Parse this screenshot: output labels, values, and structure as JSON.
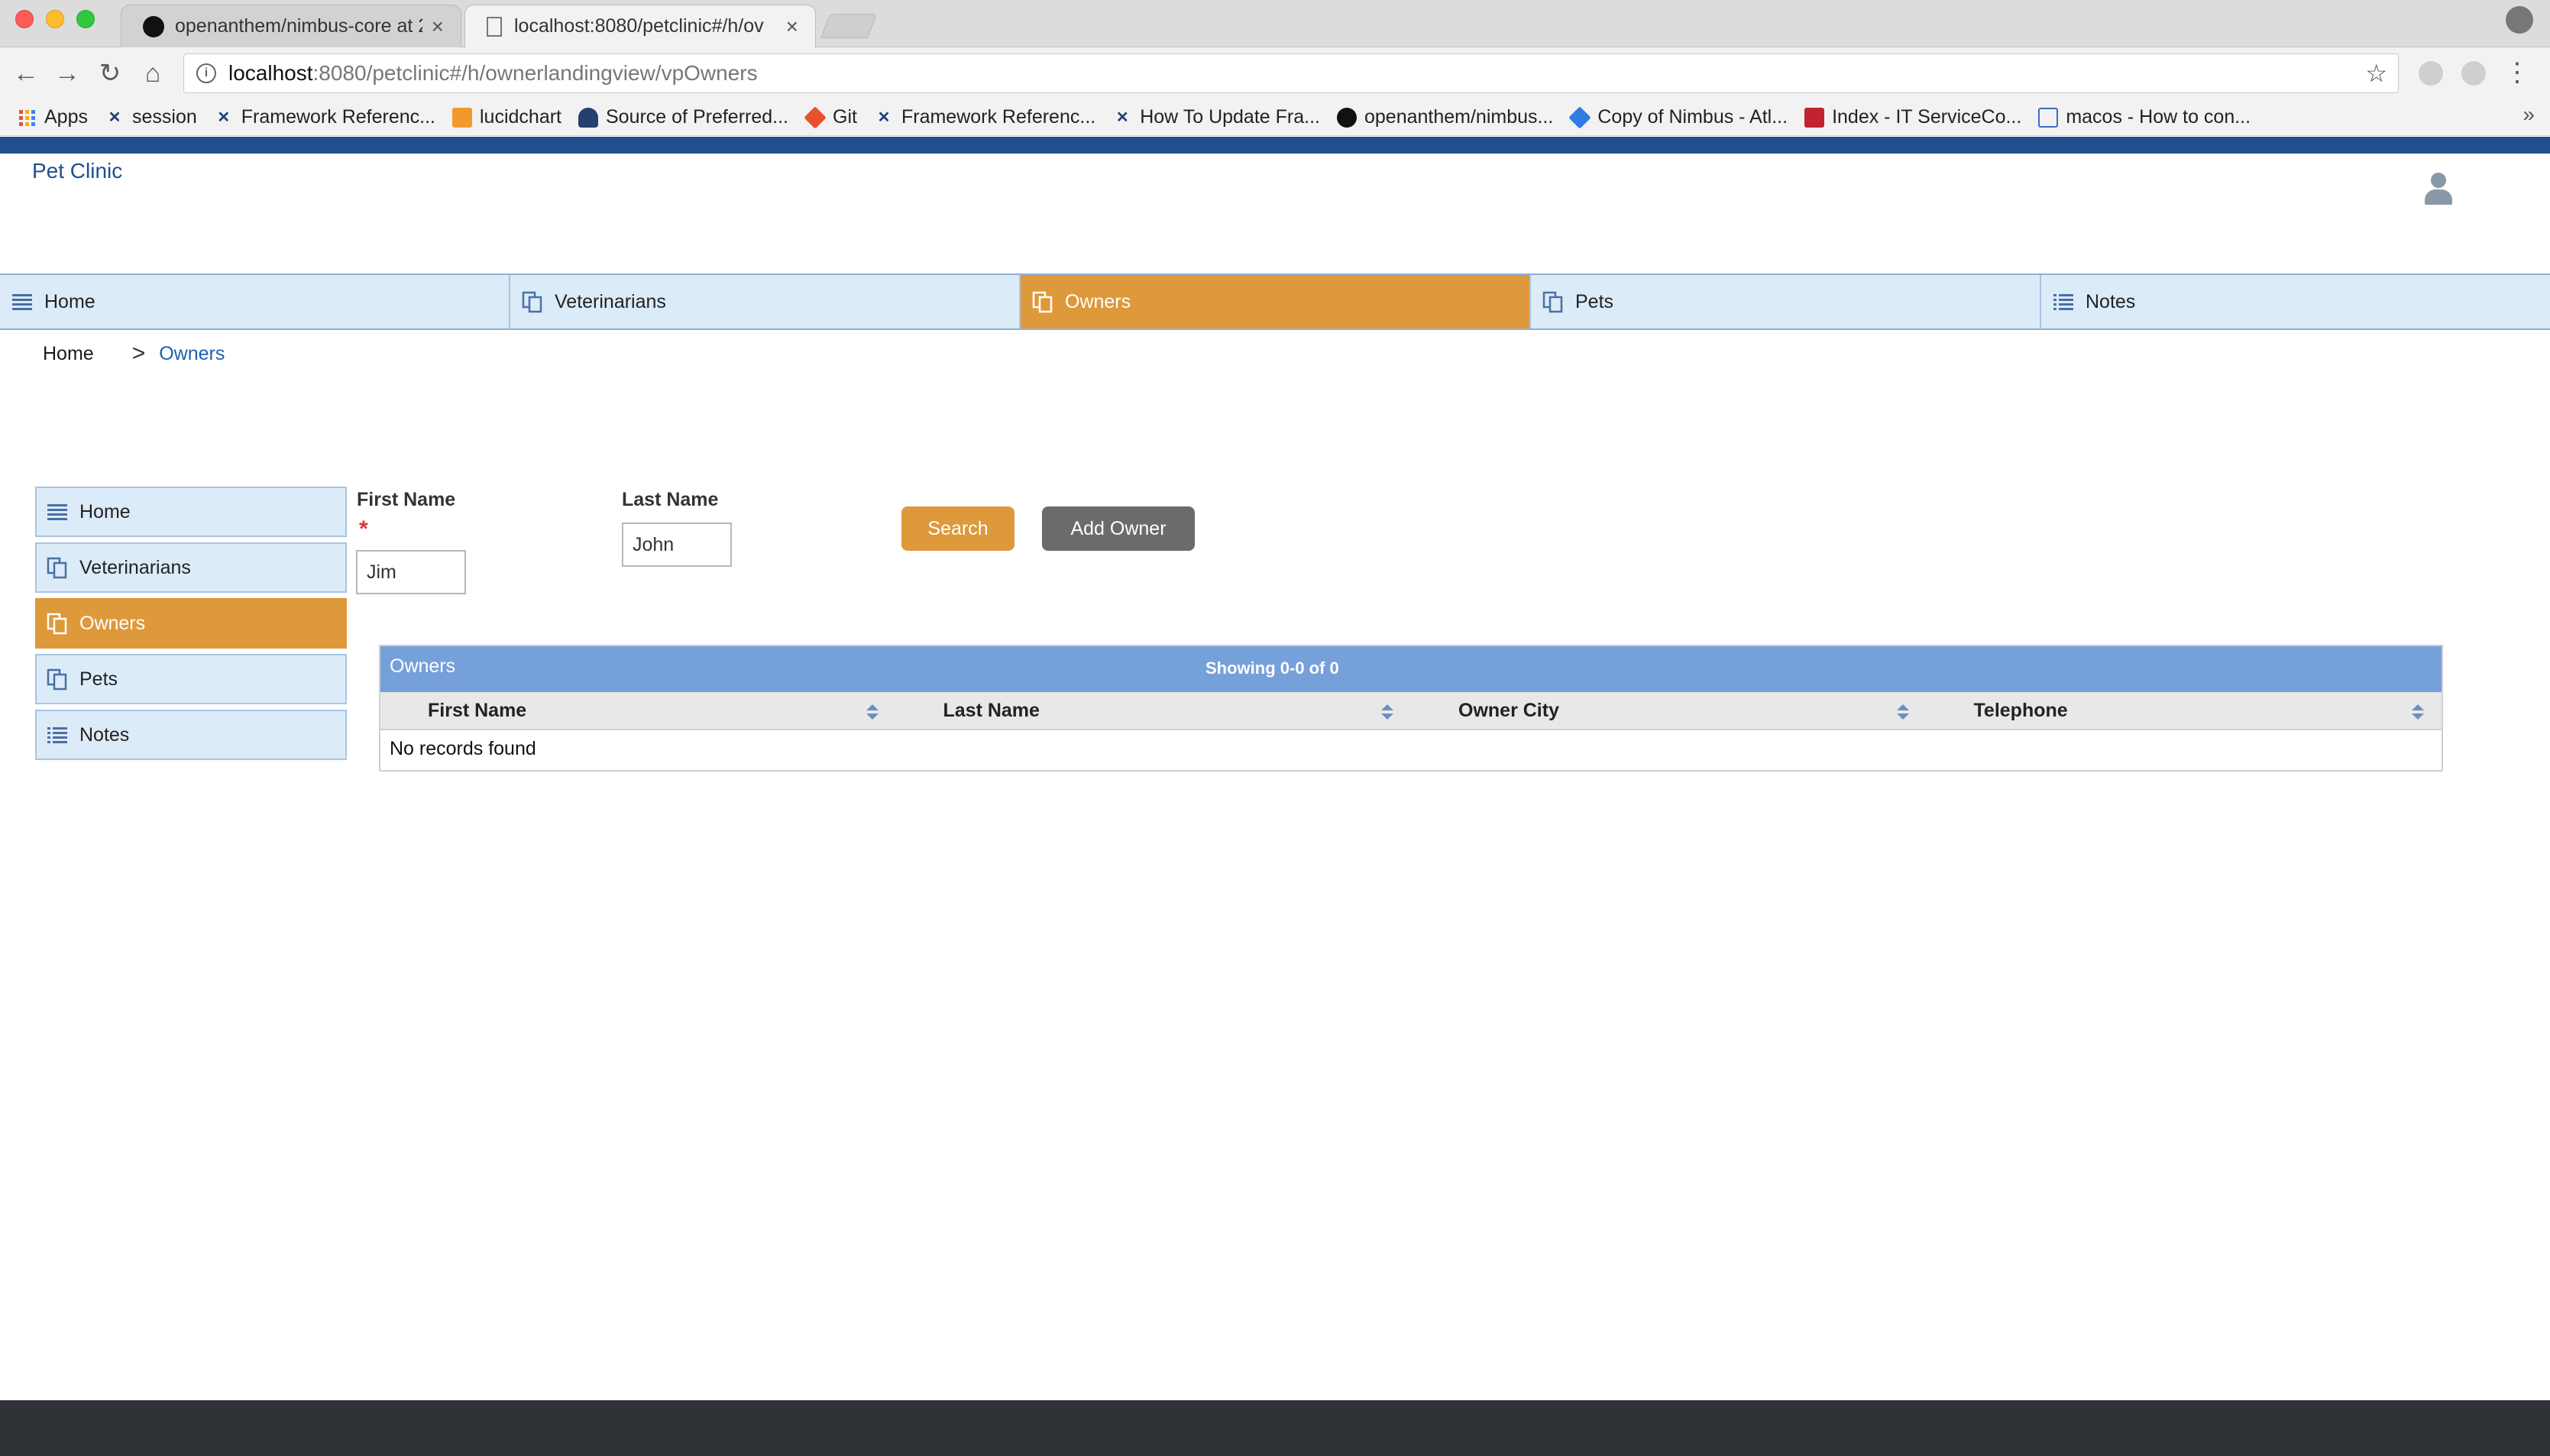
{
  "browser": {
    "tabs": [
      {
        "title": "openanthem/nimbus-core at 2",
        "active": false
      },
      {
        "title": "localhost:8080/petclinic#/h/ov",
        "active": true
      }
    ],
    "url_host": "localhost",
    "url_path": ":8080/petclinic#/h/ownerlandingview/vpOwners",
    "bookmarks": [
      {
        "label": "Apps",
        "icon": "apps-grid-icon",
        "color": "#e0533d"
      },
      {
        "label": "session",
        "icon": "framework-x-icon",
        "color": "#1f3f7a"
      },
      {
        "label": "Framework Referenc...",
        "icon": "framework-x-icon",
        "color": "#1f3f7a"
      },
      {
        "label": "lucidchart",
        "icon": "lucidchart-icon",
        "color": "#f09a2b"
      },
      {
        "label": "Source of Preferred...",
        "icon": "source-icon",
        "color": "#25406e"
      },
      {
        "label": "Git",
        "icon": "git-icon",
        "color": "#e8512d"
      },
      {
        "label": "Framework Referenc...",
        "icon": "framework-x-icon",
        "color": "#1f3f7a"
      },
      {
        "label": "How To Update Fra...",
        "icon": "framework-x-icon",
        "color": "#1f3f7a"
      },
      {
        "label": "openanthem/nimbus...",
        "icon": "github-icon",
        "color": "#111111"
      },
      {
        "label": "Copy of Nimbus - Atl...",
        "icon": "confluence-icon",
        "color": "#2f7de0"
      },
      {
        "label": "Index - IT ServiceCo...",
        "icon": "servicenow-icon",
        "color": "#c0242f"
      },
      {
        "label": "macos - How to con...",
        "icon": "document-icon",
        "color": "#3c6bc4"
      }
    ]
  },
  "app": {
    "brand": "Pet Clinic",
    "colors": {
      "primary": "#1f4f8f",
      "accent": "#dd993a",
      "nav_bg": "#dcebf8",
      "grid_header": "#76a0da"
    },
    "main_nav": [
      {
        "label": "Home",
        "icon": "list-icon",
        "active": false
      },
      {
        "label": "Veterinarians",
        "icon": "copy-icon",
        "active": false
      },
      {
        "label": "Owners",
        "icon": "copy-icon",
        "active": true
      },
      {
        "label": "Pets",
        "icon": "copy-icon",
        "active": false
      },
      {
        "label": "Notes",
        "icon": "bullet-list-icon",
        "active": false
      }
    ],
    "breadcrumb": {
      "home": "Home",
      "separator": ">",
      "current": "Owners"
    },
    "side_nav": [
      {
        "label": "Home",
        "icon": "list-icon",
        "active": false
      },
      {
        "label": "Veterinarians",
        "icon": "copy-icon",
        "active": false
      },
      {
        "label": "Owners",
        "icon": "copy-icon",
        "active": true
      },
      {
        "label": "Pets",
        "icon": "copy-icon",
        "active": false
      },
      {
        "label": "Notes",
        "icon": "bullet-list-icon",
        "active": false
      }
    ],
    "form": {
      "first_name_label": "First Name",
      "required_mark": "*",
      "first_name_value": "Jim",
      "last_name_label": "Last Name",
      "last_name_value": "John",
      "search_label": "Search",
      "add_owner_label": "Add Owner"
    },
    "grid": {
      "title": "Owners",
      "count": "Showing 0-0 of 0",
      "columns": [
        "First Name",
        "Last Name",
        "Owner City",
        "Telephone"
      ],
      "empty_message": "No records found"
    }
  }
}
